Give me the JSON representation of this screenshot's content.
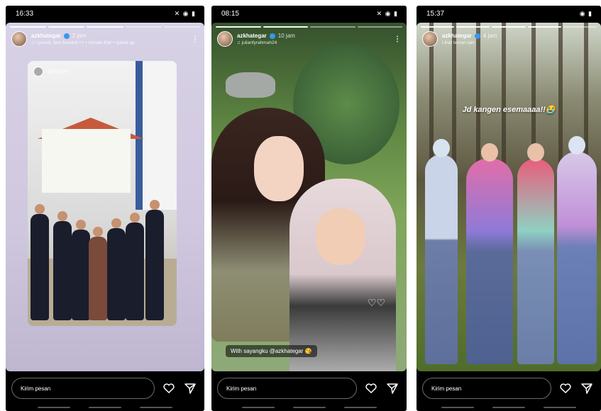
{
  "stories": [
    {
      "status_time": "16:33",
      "status_icons": "✕ ◉ ▮",
      "username": "azkhategar",
      "time_ago": "2 jam",
      "music": "♫ / pesek, fast forward ++ • remule that • speed up",
      "tagged_user": "@ensyhrl_",
      "caption": "",
      "message_placeholder": "Kirim pesan"
    },
    {
      "status_time": "08:15",
      "status_icons": "✕ ◉ ▮",
      "username": "azkhategar",
      "time_ago": "10 jam",
      "music": "♫ julianfyrahmah24",
      "caption": "With sayangku @azkhategar 😘",
      "message_placeholder": "Kirim pesan"
    },
    {
      "status_time": "15:37",
      "status_icons": "◉ ▮",
      "username": "azkhategar",
      "time_ago": "4 jam",
      "music": "Lihat teman lain",
      "caption": "Jd kangen esemaaaa!!😭",
      "message_placeholder": "Kirim pesan"
    }
  ],
  "icons": {
    "heart": "heart-icon",
    "send": "send-icon",
    "more": "more-icon"
  },
  "colors": {
    "background": "#000000",
    "verified": "#3897f0",
    "accent_story1": "#cfc7de"
  }
}
